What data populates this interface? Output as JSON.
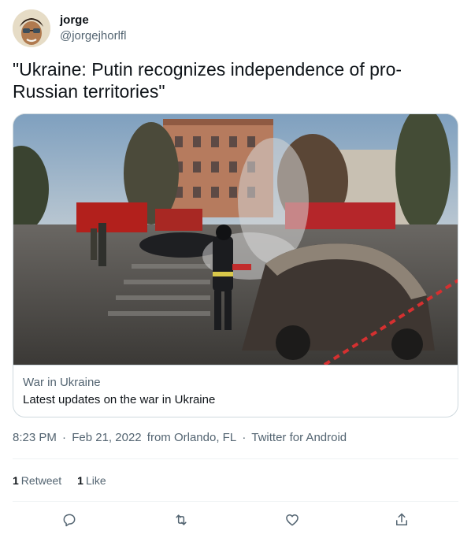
{
  "user": {
    "display_name": "jorge",
    "handle": "@jorgejhorlfl"
  },
  "tweet": {
    "text": "\"Ukraine: Putin recognizes independence of pro-Russian territories\""
  },
  "card": {
    "domain": "War in Ukraine",
    "title": "Latest updates on the war in Ukraine"
  },
  "meta": {
    "time": "8:23 PM",
    "sep1": "·",
    "date": "Feb 21, 2022",
    "location": "from Orlando, FL",
    "sep2": "·",
    "client": "Twitter for Android"
  },
  "stats": {
    "retweets_count": "1",
    "retweets_label": "Retweet",
    "likes_count": "1",
    "likes_label": "Like"
  },
  "icons": {
    "reply": "reply-icon",
    "retweet": "retweet-icon",
    "like": "heart-icon",
    "share": "share-icon"
  },
  "colors": {
    "text_primary": "#0f1419",
    "text_secondary": "#536471",
    "border": "#cfd9de"
  }
}
